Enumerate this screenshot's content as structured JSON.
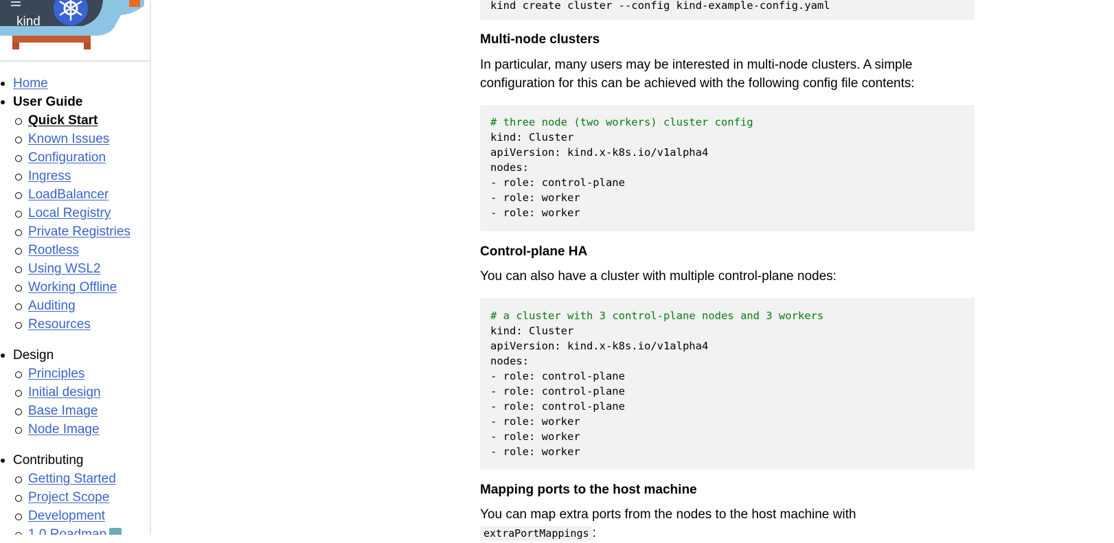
{
  "logo": {
    "text": "kind"
  },
  "sidebar": {
    "sections": [
      {
        "label": "Home",
        "link": true,
        "items": []
      },
      {
        "label": "User Guide",
        "link": false,
        "bold": true,
        "items": [
          {
            "label": "Quick Start",
            "active": true
          },
          {
            "label": "Known Issues"
          },
          {
            "label": "Configuration"
          },
          {
            "label": "Ingress"
          },
          {
            "label": "LoadBalancer"
          },
          {
            "label": "Local Registry"
          },
          {
            "label": "Private Registries"
          },
          {
            "label": "Rootless"
          },
          {
            "label": "Using WSL2"
          },
          {
            "label": "Working Offline"
          },
          {
            "label": "Auditing"
          },
          {
            "label": "Resources"
          }
        ]
      },
      {
        "label": "Design",
        "link": false,
        "items": [
          {
            "label": "Principles"
          },
          {
            "label": "Initial design"
          },
          {
            "label": "Base Image"
          },
          {
            "label": "Node Image"
          }
        ]
      },
      {
        "label": "Contributing",
        "link": false,
        "items": [
          {
            "label": "Getting Started"
          },
          {
            "label": "Project Scope"
          },
          {
            "label": "Development"
          },
          {
            "label": "1.0 Roadmap"
          }
        ]
      }
    ]
  },
  "content": {
    "top_code": "kind create cluster --config kind-example-config.yaml",
    "multinode": {
      "heading": "Multi-node clusters",
      "paragraph": "In particular, many users may be interested in multi-node clusters. A simple configuration for this can be achieved with the following config file contents:",
      "code_comment": "# three node (two workers) cluster config",
      "code_lines": [
        "kind: Cluster",
        "apiVersion: kind.x-k8s.io/v1alpha4",
        "nodes:",
        "- role: control-plane",
        "- role: worker",
        "- role: worker"
      ]
    },
    "ha": {
      "heading": "Control-plane HA",
      "paragraph": "You can also have a cluster with multiple control-plane nodes:",
      "code_comment": "# a cluster with 3 control-plane nodes and 3 workers",
      "code_lines": [
        "kind: Cluster",
        "apiVersion: kind.x-k8s.io/v1alpha4",
        "nodes:",
        "- role: control-plane",
        "- role: control-plane",
        "- role: control-plane",
        "- role: worker",
        "- role: worker",
        "- role: worker"
      ]
    },
    "ports": {
      "heading": "Mapping ports to the host machine",
      "paragraph_before": "You can map extra ports from the nodes to the host machine with ",
      "inline_code": "extraPortMappings",
      "paragraph_after": ":"
    }
  }
}
